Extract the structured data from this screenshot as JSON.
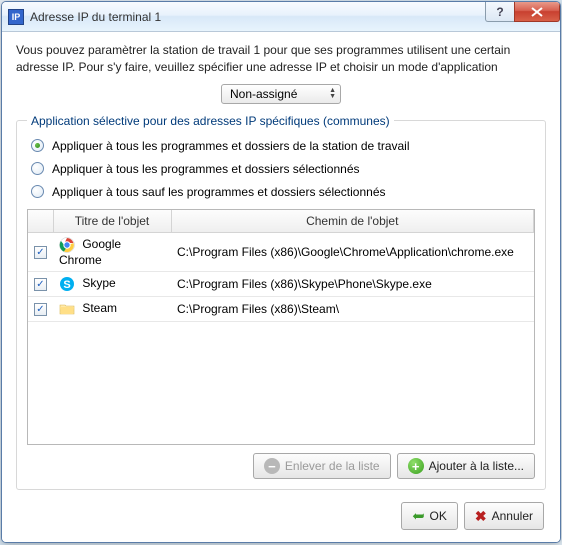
{
  "window": {
    "title": "Adresse IP du terminal 1"
  },
  "intro": "Vous pouvez paramètrer la station de travail 1 pour que ses programmes utilisent une certain adresse IP. Pour s'y faire, veuillez spécifier une adresse IP et choisir un mode d'application",
  "combo": {
    "value": "Non-assigné"
  },
  "group": {
    "legend": "Application sélective pour des adresses IP spécifiques (communes)",
    "options": [
      {
        "label": "Appliquer à tous les programmes et dossiers de la station de travail",
        "checked": true
      },
      {
        "label": "Appliquer à tous les programmes et dossiers sélectionnés",
        "checked": false
      },
      {
        "label": "Appliquer à tous sauf les programmes et dossiers sélectionnés",
        "checked": false
      }
    ],
    "columns": {
      "chk": "",
      "name": "Titre de l'objet",
      "path": "Chemin de l'objet"
    },
    "rows": [
      {
        "checked": true,
        "icon": "chrome-icon",
        "name": "Google Chrome",
        "path": "C:\\Program Files (x86)\\Google\\Chrome\\Application\\chrome.exe"
      },
      {
        "checked": true,
        "icon": "skype-icon",
        "name": "Skype",
        "path": "C:\\Program Files (x86)\\Skype\\Phone\\Skype.exe"
      },
      {
        "checked": true,
        "icon": "folder-icon",
        "name": "Steam",
        "path": "C:\\Program Files (x86)\\Steam\\"
      }
    ],
    "buttons": {
      "remove": "Enlever de la liste",
      "add": "Ajouter à la liste..."
    }
  },
  "footer": {
    "ok": "OK",
    "cancel": "Annuler"
  }
}
